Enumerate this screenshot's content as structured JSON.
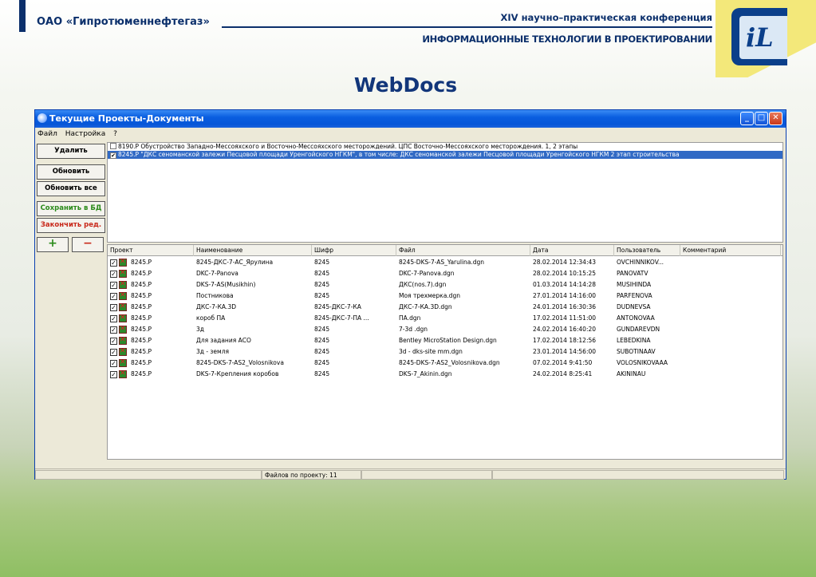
{
  "slide": {
    "company": "ОАО «Гипротюменнефтегаз»",
    "conference_line1": "XIV научно–практическая конференция",
    "conference_line2": "ИНФОРМАЦИОННЫЕ ТЕХНОЛОГИИ В ПРОЕКТИРОВАНИИ",
    "logo_text": "iL",
    "title": "WebDocs"
  },
  "window": {
    "title": "Текущие Проекты-Документы",
    "menu": [
      "Файл",
      "Настройка",
      "?"
    ],
    "controls": {
      "minimize": "_",
      "maximize": "□",
      "close": "✕"
    }
  },
  "buttons": {
    "delete": "Удалить",
    "refresh": "Обновить",
    "refresh_all": "Обновить все",
    "save_db": "Сохранить в БД",
    "finish_edit": "Закончить ред.",
    "add": "+",
    "remove": "−"
  },
  "projects": [
    {
      "checked": false,
      "selected": false,
      "text": "8190.P Обустройство Западно-Мессояхского и Восточно-Мессояхского месторождений. ЦПС Восточно-Мессояхского месторождения. 1, 2 этапы"
    },
    {
      "checked": true,
      "selected": true,
      "text": "8245.P \"ДКС сеноманской залежи Песцовой площади Уренгойского НГКМ\", в том числе: ДКС сеноманской залежи Песцовой площади Уренгойского НГКМ 2 этап строительства"
    }
  ],
  "grid": {
    "columns": [
      "Проект",
      "Наименование",
      "Шифр",
      "Файл",
      "Дата",
      "Пользователь",
      "Комментарий"
    ],
    "rows": [
      [
        "8245.P",
        "8245-ДКС-7-АС_Ярулина",
        "8245",
        "8245-DKS-7-AS_Yarulina.dgn",
        "28.02.2014 12:34:43",
        "OVCHINNIKOV...",
        ""
      ],
      [
        "8245.P",
        "DKC-7-Panova",
        "8245",
        "DKC-7-Panova.dgn",
        "28.02.2014 10:15:25",
        "PANOVATV",
        ""
      ],
      [
        "8245.P",
        "DKS-7-AS(Musikhin)",
        "8245",
        "ДКС(nos.7).dgn",
        "01.03.2014 14:14:28",
        "MUSIHINDA",
        ""
      ],
      [
        "8245.P",
        "Постникова",
        "8245",
        "Моя трехмерка.dgn",
        "27.01.2014 14:16:00",
        "PARFENOVA",
        ""
      ],
      [
        "8245.P",
        "ДКС-7-КА.3D",
        "8245-ДКС-7-КА",
        "ДКС-7-КА.3D.dgn",
        "24.01.2014 16:30:36",
        "DUDNEVSA",
        ""
      ],
      [
        "8245.P",
        "короб ПА",
        "8245-ДКС-7-ПА      ...",
        "ПА.dgn",
        "17.02.2014 11:51:00",
        "ANTONOVAA",
        ""
      ],
      [
        "8245.P",
        "3д",
        "8245",
        "7-3d .dgn",
        "24.02.2014 16:40:20",
        "GUNDAREVDN",
        ""
      ],
      [
        "8245.P",
        "Для задания АСО",
        "8245",
        "Bentley MicroStation Design.dgn",
        "17.02.2014 18:12:56",
        "LEBEDKINA",
        ""
      ],
      [
        "8245.P",
        "3д - земля",
        "8245",
        "3d - dks-site mm.dgn",
        "23.01.2014 14:56:00",
        "SUBOTINAAV",
        ""
      ],
      [
        "8245.P",
        "8245-DKS-7-AS2_Volosnikova",
        "8245",
        "8245-DKS-7-AS2_Volosnikova.dgn",
        "07.02.2014 9:41:50",
        "VOLOSNIKOVAAA",
        ""
      ],
      [
        "8245.P",
        "DKS-7-Крепления коробов",
        "8245",
        "DKS-7_Akinin.dgn",
        "24.02.2014 8:25:41",
        "AKININAU",
        ""
      ]
    ]
  },
  "status": {
    "files_label": "Файлов по проекту: 11"
  }
}
